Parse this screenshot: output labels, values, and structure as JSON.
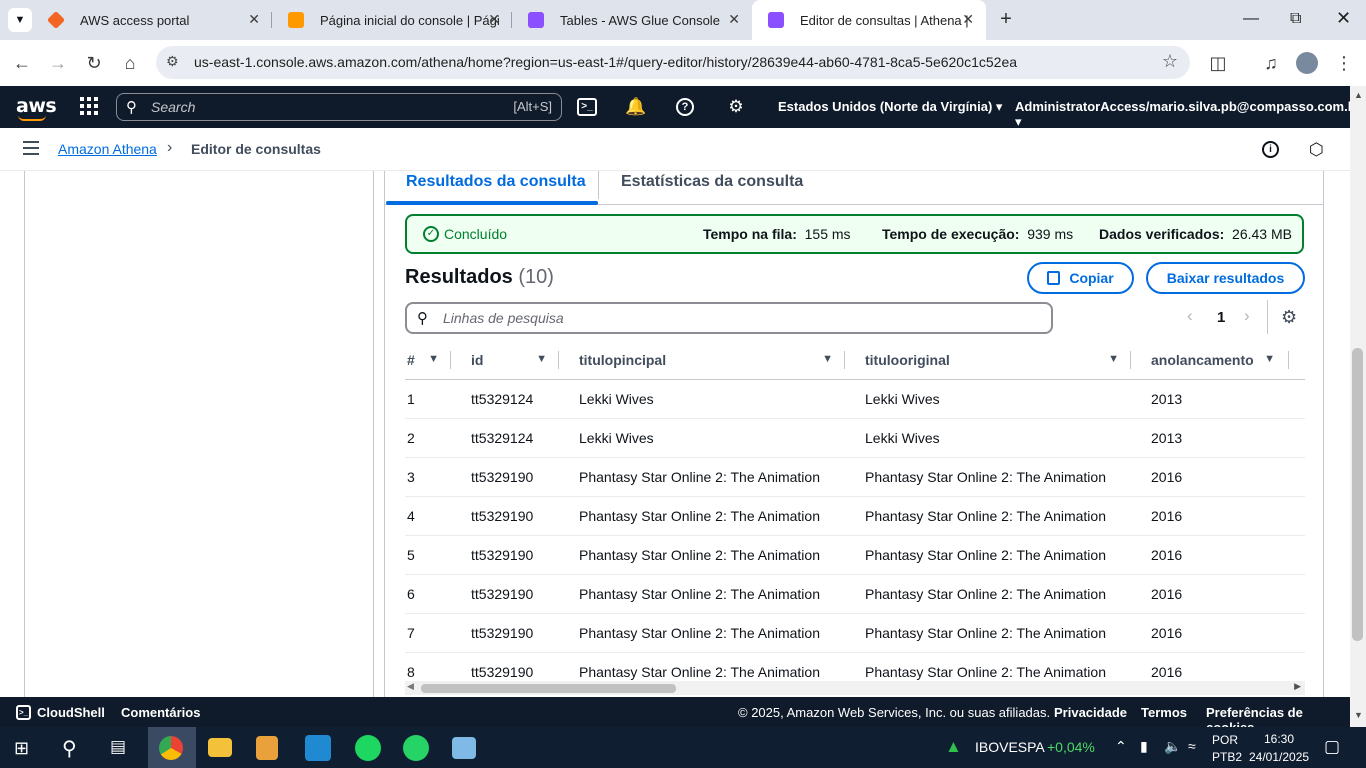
{
  "browser": {
    "tabs": [
      {
        "title": "AWS access portal",
        "color": "#f26522"
      },
      {
        "title": "Página inicial do console | Págir",
        "color": "#ff9900"
      },
      {
        "title": "Tables - AWS Glue Console",
        "color": "#8c4fff"
      },
      {
        "title": "Editor de consultas | Athena | us",
        "color": "#8c4fff"
      }
    ],
    "new_tab": "+",
    "url": "us-east-1.console.aws.amazon.com/athena/home?region=us-east-1#/query-editor/history/28639e44-ab60-4781-8ca5-5e620c1c52ea"
  },
  "aws_header": {
    "logo": "aws",
    "search_placeholder": "Search",
    "search_shortcut": "[Alt+S]",
    "region": "Estados Unidos (Norte da Virgínia) ▾",
    "account": "AdministratorAccess/mario.silva.pb@compasso.com.br ▾"
  },
  "breadcrumb": {
    "root": "Amazon Athena",
    "current": "Editor de consultas"
  },
  "results_tabs": {
    "results": "Resultados da consulta",
    "stats": "Estatísticas da consulta"
  },
  "status": {
    "state": "Concluído",
    "queue_label": "Tempo na fila:",
    "queue_value": "155 ms",
    "exec_label": "Tempo de execução:",
    "exec_value": "939 ms",
    "data_label": "Dados verificados:",
    "data_value": "26.43 MB",
    "color": "#00802f"
  },
  "results": {
    "title": "Resultados",
    "count": "(10)",
    "copy_label": "Copiar",
    "download_label": "Baixar resultados",
    "search_placeholder": "Linhas de pesquisa",
    "page": "1",
    "columns": [
      "#",
      "id",
      "titulopincipal",
      "titulooriginal",
      "anolancamento"
    ],
    "rows": [
      [
        "1",
        "tt5329124",
        "Lekki Wives",
        "Lekki Wives",
        "2013"
      ],
      [
        "2",
        "tt5329124",
        "Lekki Wives",
        "Lekki Wives",
        "2013"
      ],
      [
        "3",
        "tt5329190",
        "Phantasy Star Online 2: The Animation",
        "Phantasy Star Online 2: The Animation",
        "2016"
      ],
      [
        "4",
        "tt5329190",
        "Phantasy Star Online 2: The Animation",
        "Phantasy Star Online 2: The Animation",
        "2016"
      ],
      [
        "5",
        "tt5329190",
        "Phantasy Star Online 2: The Animation",
        "Phantasy Star Online 2: The Animation",
        "2016"
      ],
      [
        "6",
        "tt5329190",
        "Phantasy Star Online 2: The Animation",
        "Phantasy Star Online 2: The Animation",
        "2016"
      ],
      [
        "7",
        "tt5329190",
        "Phantasy Star Online 2: The Animation",
        "Phantasy Star Online 2: The Animation",
        "2016"
      ],
      [
        "8",
        "tt5329190",
        "Phantasy Star Online 2: The Animation",
        "Phantasy Star Online 2: The Animation",
        "2016"
      ]
    ]
  },
  "footer": {
    "cloudshell": "CloudShell",
    "feedback": "Comentários",
    "copyright": "© 2025, Amazon Web Services, Inc. ou suas afiliadas.",
    "privacy": "Privacidade",
    "terms": "Termos",
    "cookies": "Preferências de cookies"
  },
  "taskbar": {
    "ticker_name": "IBOVESPA",
    "ticker_change": "+0,04%",
    "lang_top": "POR",
    "lang_bottom": "PTB2",
    "time": "16:30",
    "date": "24/01/2025"
  }
}
